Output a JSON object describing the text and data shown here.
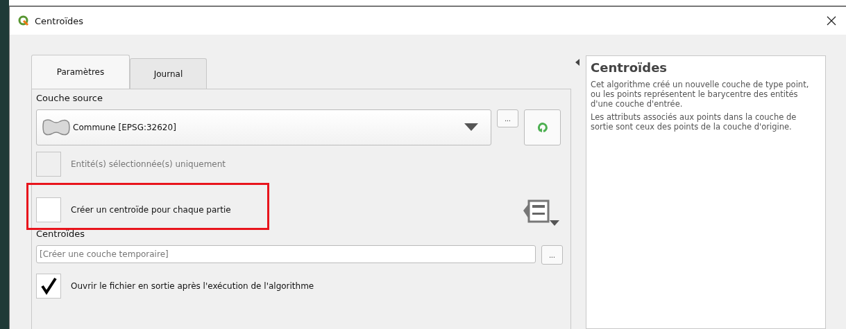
{
  "window": {
    "title": "Centroïdes"
  },
  "tabs": [
    {
      "label": "Paramètres",
      "selected": true
    },
    {
      "label": "Journal",
      "selected": false
    }
  ],
  "source": {
    "label": "Couche source",
    "value": "Commune [EPSG:32620]",
    "browse": "...",
    "selected_only": {
      "label": "Entité(s) sélectionnée(s) uniquement",
      "checked": false,
      "disabled": true
    }
  },
  "per_part": {
    "label": "Créer un centroïde pour chaque partie",
    "checked": false,
    "disabled": false
  },
  "output": {
    "label": "Centroïdes",
    "placeholder": "[Créer une couche temporaire]",
    "browse": "..."
  },
  "open_output": {
    "label": "Ouvrir le fichier en sortie après l'exécution de l'algorithme",
    "checked": true,
    "disabled": false
  },
  "help": {
    "title": "Centroïdes",
    "paragraphs": [
      "Cet algorithme créé un nouvelle couche de type point, ou les points représentent le barycentre des entités d'une couche d'entrée.",
      "Les attributs associés aux points dans la couche de sortie sont ceux des points de la couche d'origine."
    ]
  }
}
